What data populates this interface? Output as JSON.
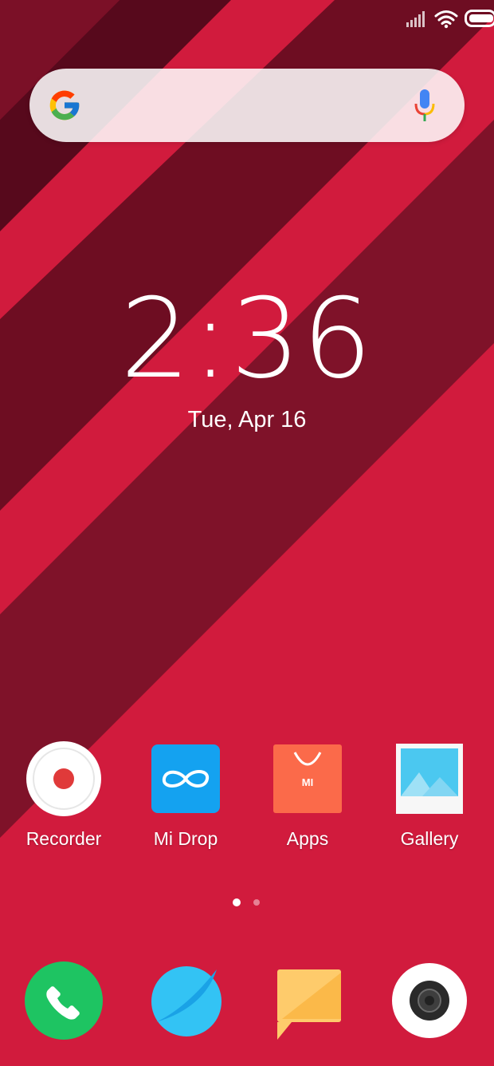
{
  "status_bar": {
    "signal_icon": "signal-icon",
    "wifi_icon": "wifi-icon",
    "battery_icon": "battery-icon"
  },
  "search": {
    "logo_icon": "google-g-icon",
    "voice_icon": "mic-icon"
  },
  "clock": {
    "time": "2:36",
    "date": "Tue, Apr 16"
  },
  "apps": [
    {
      "label": "Recorder",
      "icon": "recorder-icon"
    },
    {
      "label": "Mi Drop",
      "icon": "mi-drop-icon"
    },
    {
      "label": "Apps",
      "icon": "mi-apps-store-icon"
    },
    {
      "label": "Gallery",
      "icon": "gallery-icon"
    }
  ],
  "page_indicator": {
    "pages": 2,
    "current": 1
  },
  "dock": [
    {
      "icon": "phone-icon"
    },
    {
      "icon": "browser-icon"
    },
    {
      "icon": "messages-icon"
    },
    {
      "icon": "camera-icon"
    }
  ],
  "colors": {
    "wallpaper": "#d11b3d",
    "stripe_dark": "#5a0a1c",
    "stripe_mid": "#7e1128"
  }
}
